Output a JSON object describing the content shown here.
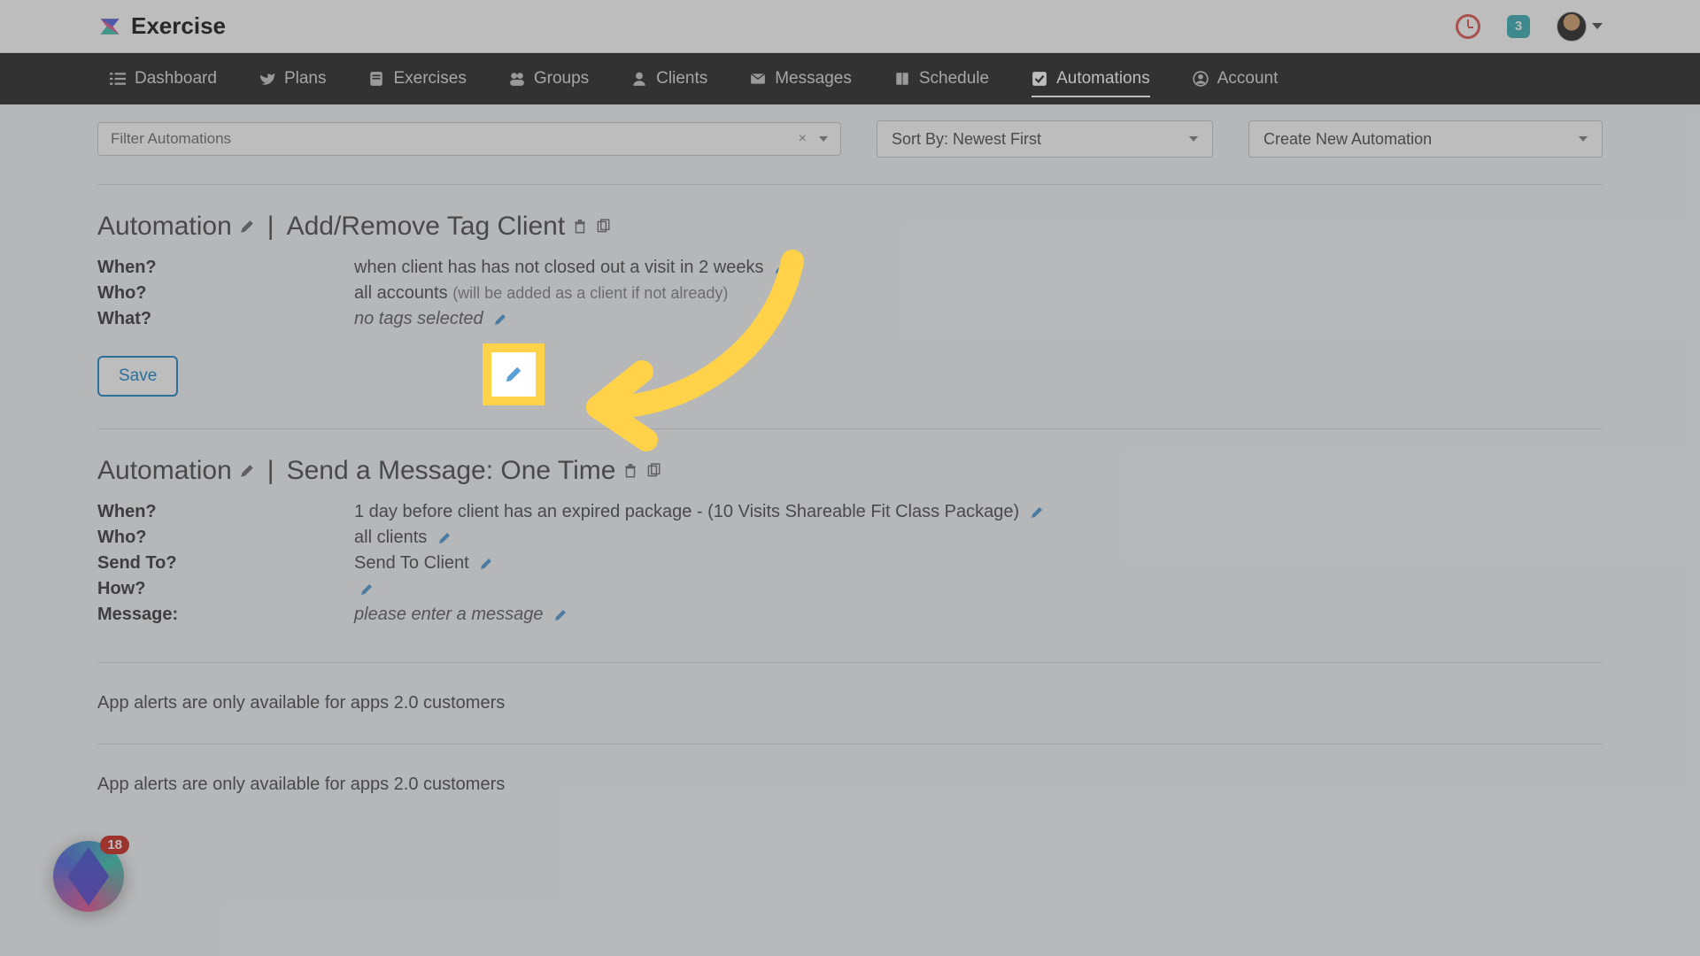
{
  "brand": {
    "name": "Exercise"
  },
  "header": {
    "notif_count": "3"
  },
  "nav": {
    "dashboard": "Dashboard",
    "plans": "Plans",
    "exercises": "Exercises",
    "groups": "Groups",
    "clients": "Clients",
    "messages": "Messages",
    "schedule": "Schedule",
    "automations": "Automations",
    "account": "Account"
  },
  "filters": {
    "placeholder": "Filter Automations",
    "sort_label": "Sort By: Newest First",
    "create_label": "Create New Automation"
  },
  "automation1": {
    "title_prefix": "Automation",
    "title_suffix": "Add/Remove Tag Client",
    "when_label": "When?",
    "when_value": "when client has has not closed out a visit in 2 weeks",
    "who_label": "Who?",
    "who_value": "all accounts",
    "who_note": "(will be added as a client if not already)",
    "what_label": "What?",
    "what_value": "no tags selected",
    "save_label": "Save"
  },
  "automation2": {
    "title_prefix": "Automation",
    "title_suffix": "Send a Message: One Time",
    "when_label": "When?",
    "when_value": "1 day before client has an expired package - (10 Visits Shareable Fit Class Package)",
    "who_label": "Who?",
    "who_value": "all clients",
    "sendto_label": "Send To?",
    "sendto_value": "Send To Client",
    "how_label": "How?",
    "message_label": "Message:",
    "message_value": "please enter a message"
  },
  "alert_note": "App alerts are only available for apps 2.0 customers",
  "app_bubble": {
    "count": "18"
  }
}
